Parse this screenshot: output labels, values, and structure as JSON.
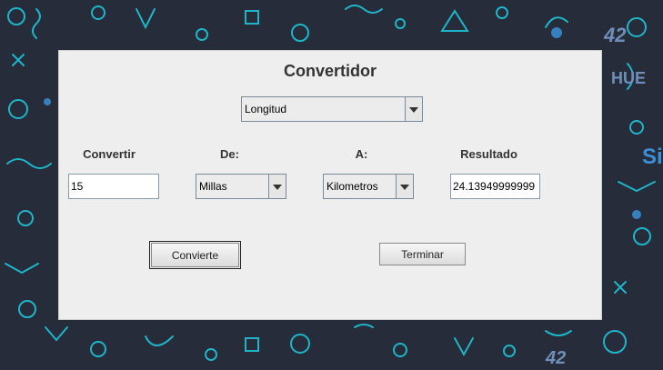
{
  "window": {
    "title": "Convertidor"
  },
  "magnitude_select": {
    "value": "Longitud"
  },
  "labels": {
    "convertir": "Convertir",
    "de": "De:",
    "a": "A:",
    "resultado": "Resultado"
  },
  "inputs": {
    "convertir_value": "15",
    "resultado_value": "24.13949999999"
  },
  "unit_from": {
    "value": "Millas"
  },
  "unit_to": {
    "value": "Kilometros"
  },
  "buttons": {
    "convert": "Convierte",
    "exit": "Terminar"
  },
  "wallpaper": {
    "text_hue": "HUE",
    "text_42": "42",
    "text_si": "Si",
    "bg_color": "#262c3a",
    "accent_teal": "#1fb5c9",
    "accent_blue": "#3a8fd8"
  }
}
